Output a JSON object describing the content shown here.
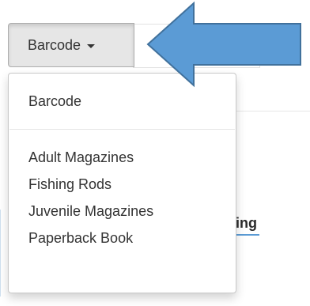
{
  "toggle": {
    "label": "Barcode"
  },
  "menu": {
    "primary_item": "Barcode",
    "items": [
      "Adult Magazines",
      "Fishing Rods",
      "Juvenile Magazines",
      "Paperback Book"
    ]
  },
  "background": {
    "partial_heading": "ing"
  },
  "colors": {
    "arrow_fill": "#5b9bd5",
    "arrow_stroke": "#41719c",
    "button_bg": "#e6e6e6"
  },
  "icons": {
    "toggle_caret": "caret-down-icon",
    "pointer": "right-pointing-arrow-icon"
  }
}
